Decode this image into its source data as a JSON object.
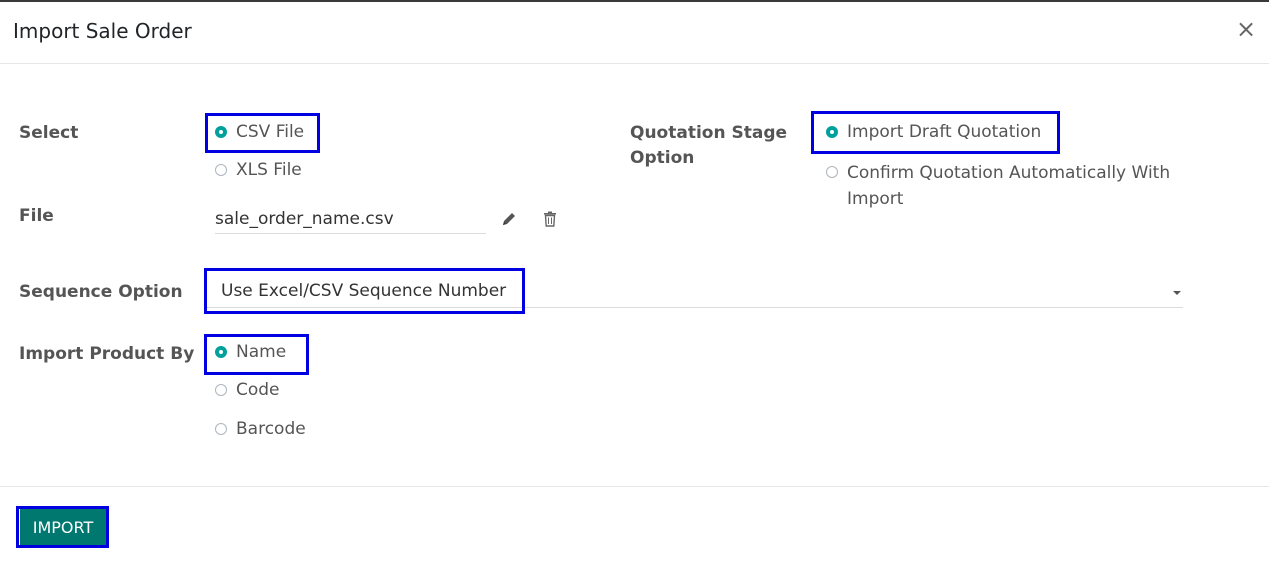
{
  "dialog": {
    "title": "Import Sale Order",
    "close_symbol": "×"
  },
  "form": {
    "select_label": "Select",
    "select_options": [
      {
        "label": "CSV File",
        "checked": true
      },
      {
        "label": "XLS File",
        "checked": false
      }
    ],
    "file_label": "File",
    "file_value": "sale_order_name.csv",
    "quotation_label_line1": "Quotation Stage",
    "quotation_label_line2": "Option",
    "quotation_options": [
      {
        "label": "Import Draft Quotation",
        "checked": true
      },
      {
        "label_line1": "Confirm Quotation Automatically With",
        "label_line2": "Import",
        "checked": false
      }
    ],
    "sequence_label": "Sequence Option",
    "sequence_value": "Use Excel/CSV Sequence Number",
    "product_label": "Import Product By",
    "product_options": [
      {
        "label": "Name",
        "checked": true
      },
      {
        "label": "Code",
        "checked": false
      },
      {
        "label": "Barcode",
        "checked": false
      }
    ]
  },
  "footer": {
    "import_label": "IMPORT"
  },
  "icons": {
    "edit": "pencil-icon",
    "delete": "trash-icon",
    "caret": "caret-down-icon"
  },
  "colors": {
    "accent": "#00a09d",
    "button": "#00776f",
    "highlight": "#0000e0"
  }
}
